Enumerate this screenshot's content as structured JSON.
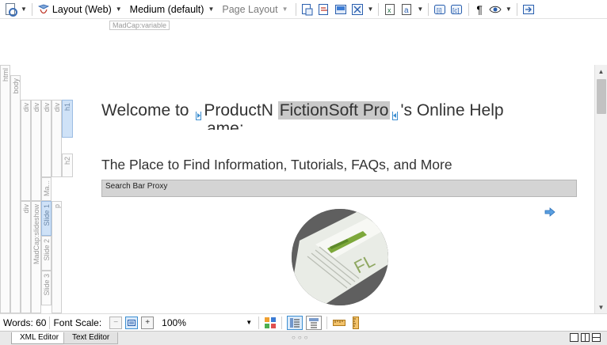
{
  "toolbar": {
    "layout_label": "Layout (Web)",
    "medium_label": "Medium (default)",
    "page_layout_label": "Page Layout",
    "show_marks_label": "¶"
  },
  "variable_tag": "MadCap:variable",
  "structure_bars": {
    "html": "html",
    "body": "body",
    "div1": "div",
    "div2": "div",
    "div3": "div",
    "div4": "div",
    "h1": "h1",
    "h2": "h2",
    "ma": "Ma...",
    "div5": "div",
    "slideshow": "MadCap:slideshow",
    "slide1": "Slide 1",
    "slide2": "Slide 2",
    "slide3": "Slide 3",
    "p": "p"
  },
  "content": {
    "h1_prefix": "Welcome to",
    "h1_variable_name": "ProductN",
    "h1_variable_value": "FictionSoft Pro",
    "h1_suffix": "'s Online Help",
    "h1_clipped": "ame;",
    "h2": "The Place to Find Information, Tutorials, FAQs, and More",
    "search_proxy": "Search Bar Proxy"
  },
  "status": {
    "words_label": "Words: 60",
    "font_scale_label": "Font Scale:",
    "zoom_value": "100%"
  },
  "tabs": [
    {
      "label": "XML Editor"
    },
    {
      "label": "Text Editor"
    }
  ],
  "colors": {
    "accent": "#3d8fd1",
    "variable_highlight": "#c9c9c9",
    "selected_bar": "#cfe2f7"
  }
}
